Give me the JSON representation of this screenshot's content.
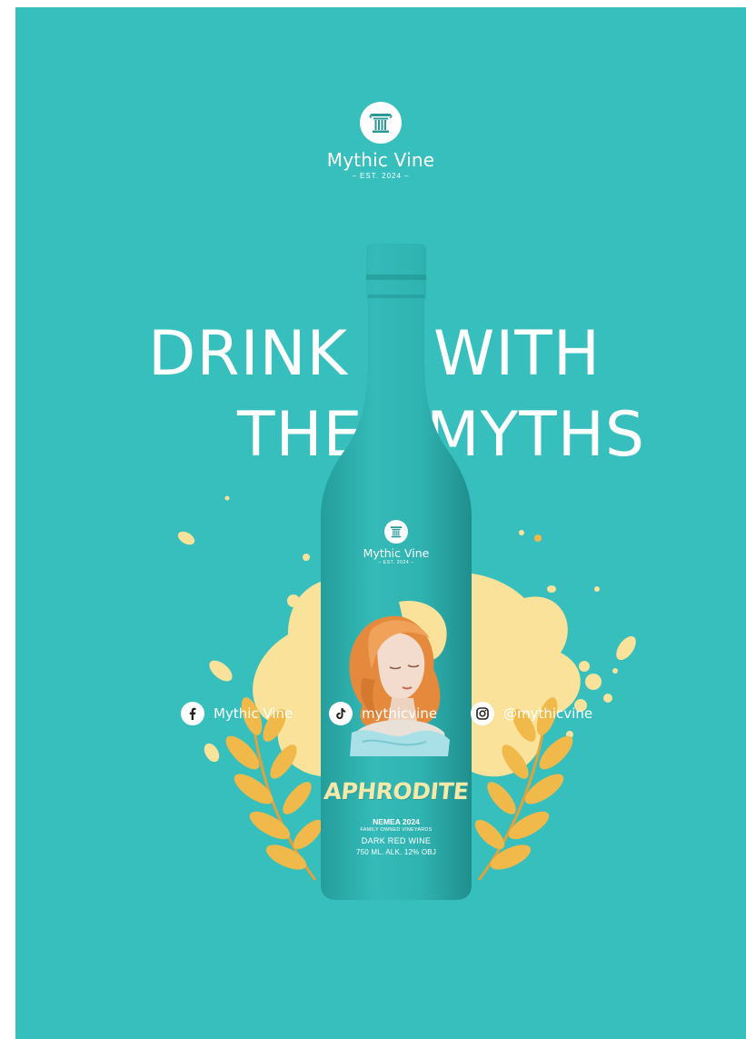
{
  "brand": {
    "name": "Mythic Vine",
    "est": "– EST. 2024 –",
    "icon": "column-icon"
  },
  "headline": {
    "line1_left": "DRINK",
    "line1_right": "WITH",
    "line2_left": "THE",
    "line2_right": "MYTHS"
  },
  "label": {
    "brand_name": "Mythic Vine",
    "brand_est": "– EST. 2024 –",
    "title": "APHRODITE",
    "region": "NEMEA 2024",
    "family": "FAMILY OWNED VINEYARDS",
    "type": "DARK RED WINE",
    "volume": "750 ML. ALK. 12% OBJ"
  },
  "socials": [
    {
      "icon": "facebook-icon",
      "text": "Mythic Vine"
    },
    {
      "icon": "tiktok-icon",
      "text": "mythicvine"
    },
    {
      "icon": "instagram-icon",
      "text": "@mythicvine"
    }
  ],
  "colors": {
    "background": "#36bfbd",
    "bottle": "#2fb3b1",
    "splash": "#fbe29a",
    "laurel": "#f0b94a",
    "title": "#f4e9a8"
  }
}
